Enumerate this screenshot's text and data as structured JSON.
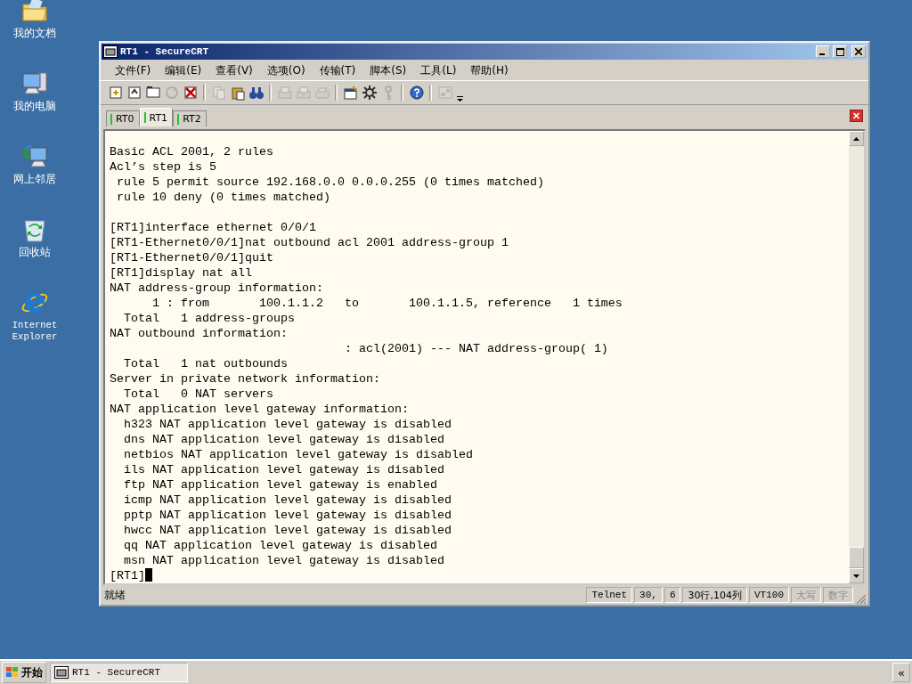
{
  "desktop_icons": [
    {
      "label": "我的文档"
    },
    {
      "label": "我的电脑"
    },
    {
      "label": "网上邻居"
    },
    {
      "label": "回收站"
    },
    {
      "label": "Internet Explorer"
    }
  ],
  "window": {
    "title": "RT1 - SecureCRT",
    "menu": [
      "文件(F)",
      "编辑(E)",
      "查看(V)",
      "选项(O)",
      "传输(T)",
      "脚本(S)",
      "工具(L)",
      "帮助(H)"
    ],
    "toolbar": [
      {
        "kind": "button",
        "disabled": false
      },
      {
        "kind": "button",
        "disabled": false
      },
      {
        "kind": "button",
        "disabled": false
      },
      {
        "kind": "button",
        "disabled": true
      },
      {
        "kind": "button",
        "disabled": false
      },
      {
        "kind": "separator"
      },
      {
        "kind": "button",
        "disabled": true
      },
      {
        "kind": "button",
        "disabled": false
      },
      {
        "kind": "button",
        "disabled": false
      },
      {
        "kind": "separator"
      },
      {
        "kind": "button",
        "disabled": true
      },
      {
        "kind": "button",
        "disabled": true
      },
      {
        "kind": "button",
        "disabled": true
      },
      {
        "kind": "separator"
      },
      {
        "kind": "button",
        "disabled": false
      },
      {
        "kind": "button",
        "disabled": false
      },
      {
        "kind": "button",
        "disabled": true
      },
      {
        "kind": "separator"
      },
      {
        "kind": "button",
        "disabled": false
      },
      {
        "kind": "separator"
      },
      {
        "kind": "button",
        "disabled": true
      }
    ],
    "tabs": [
      {
        "label": "RT0",
        "selected": false
      },
      {
        "label": "RT1",
        "selected": true
      },
      {
        "label": "RT2",
        "selected": false
      }
    ],
    "terminal": {
      "blocks": [
        [
          "Basic ACL 2001, 2 rules",
          "Acl’s step is 5",
          " rule 5 permit source 192.168.0.0 0.0.0.255 (0 times matched)",
          " rule 10 deny (0 times matched)"
        ],
        [
          "[RT1]interface ethernet 0/0/1",
          "[RT1-Ethernet0/0/1]nat outbound acl 2001 address-group 1",
          "[RT1-Ethernet0/0/1]quit",
          "[RT1]display nat all",
          "NAT address-group information:",
          "      1 : from       100.1.1.2   to       100.1.1.5, reference   1 times",
          "  Total   1 address-groups",
          "NAT outbound information:",
          "                                 : acl(2001) --- NAT address-group( 1)",
          "  Total   1 nat outbounds",
          "Server in private network information:",
          "  Total   0 NAT servers",
          "NAT application level gateway information:",
          "  h323 NAT application level gateway is disabled",
          "  dns NAT application level gateway is disabled",
          "  netbios NAT application level gateway is disabled",
          "  ils NAT application level gateway is disabled",
          "  ftp NAT application level gateway is enabled",
          "  icmp NAT application level gateway is disabled",
          "  pptp NAT application level gateway is disabled",
          "  hwcc NAT application level gateway is disabled",
          "  qq NAT application level gateway is disabled",
          "  msn NAT application level gateway is disabled"
        ]
      ],
      "prompt": "[RT1]"
    },
    "status_bar": {
      "message": "就绪",
      "fields": [
        {
          "text": "Telnet",
          "disabled": false
        },
        {
          "text": "30,",
          "disabled": false
        },
        {
          "text": "6",
          "disabled": false
        },
        {
          "text": "30行,104列",
          "disabled": false
        },
        {
          "text": "VT100",
          "disabled": false
        },
        {
          "text": "大写",
          "disabled": true
        },
        {
          "text": "数字",
          "disabled": true
        }
      ]
    }
  },
  "taskbar": {
    "start": "开始",
    "tasks": [
      {
        "label": "RT1 - SecureCRT",
        "selected": true
      }
    ],
    "expand": "«"
  }
}
